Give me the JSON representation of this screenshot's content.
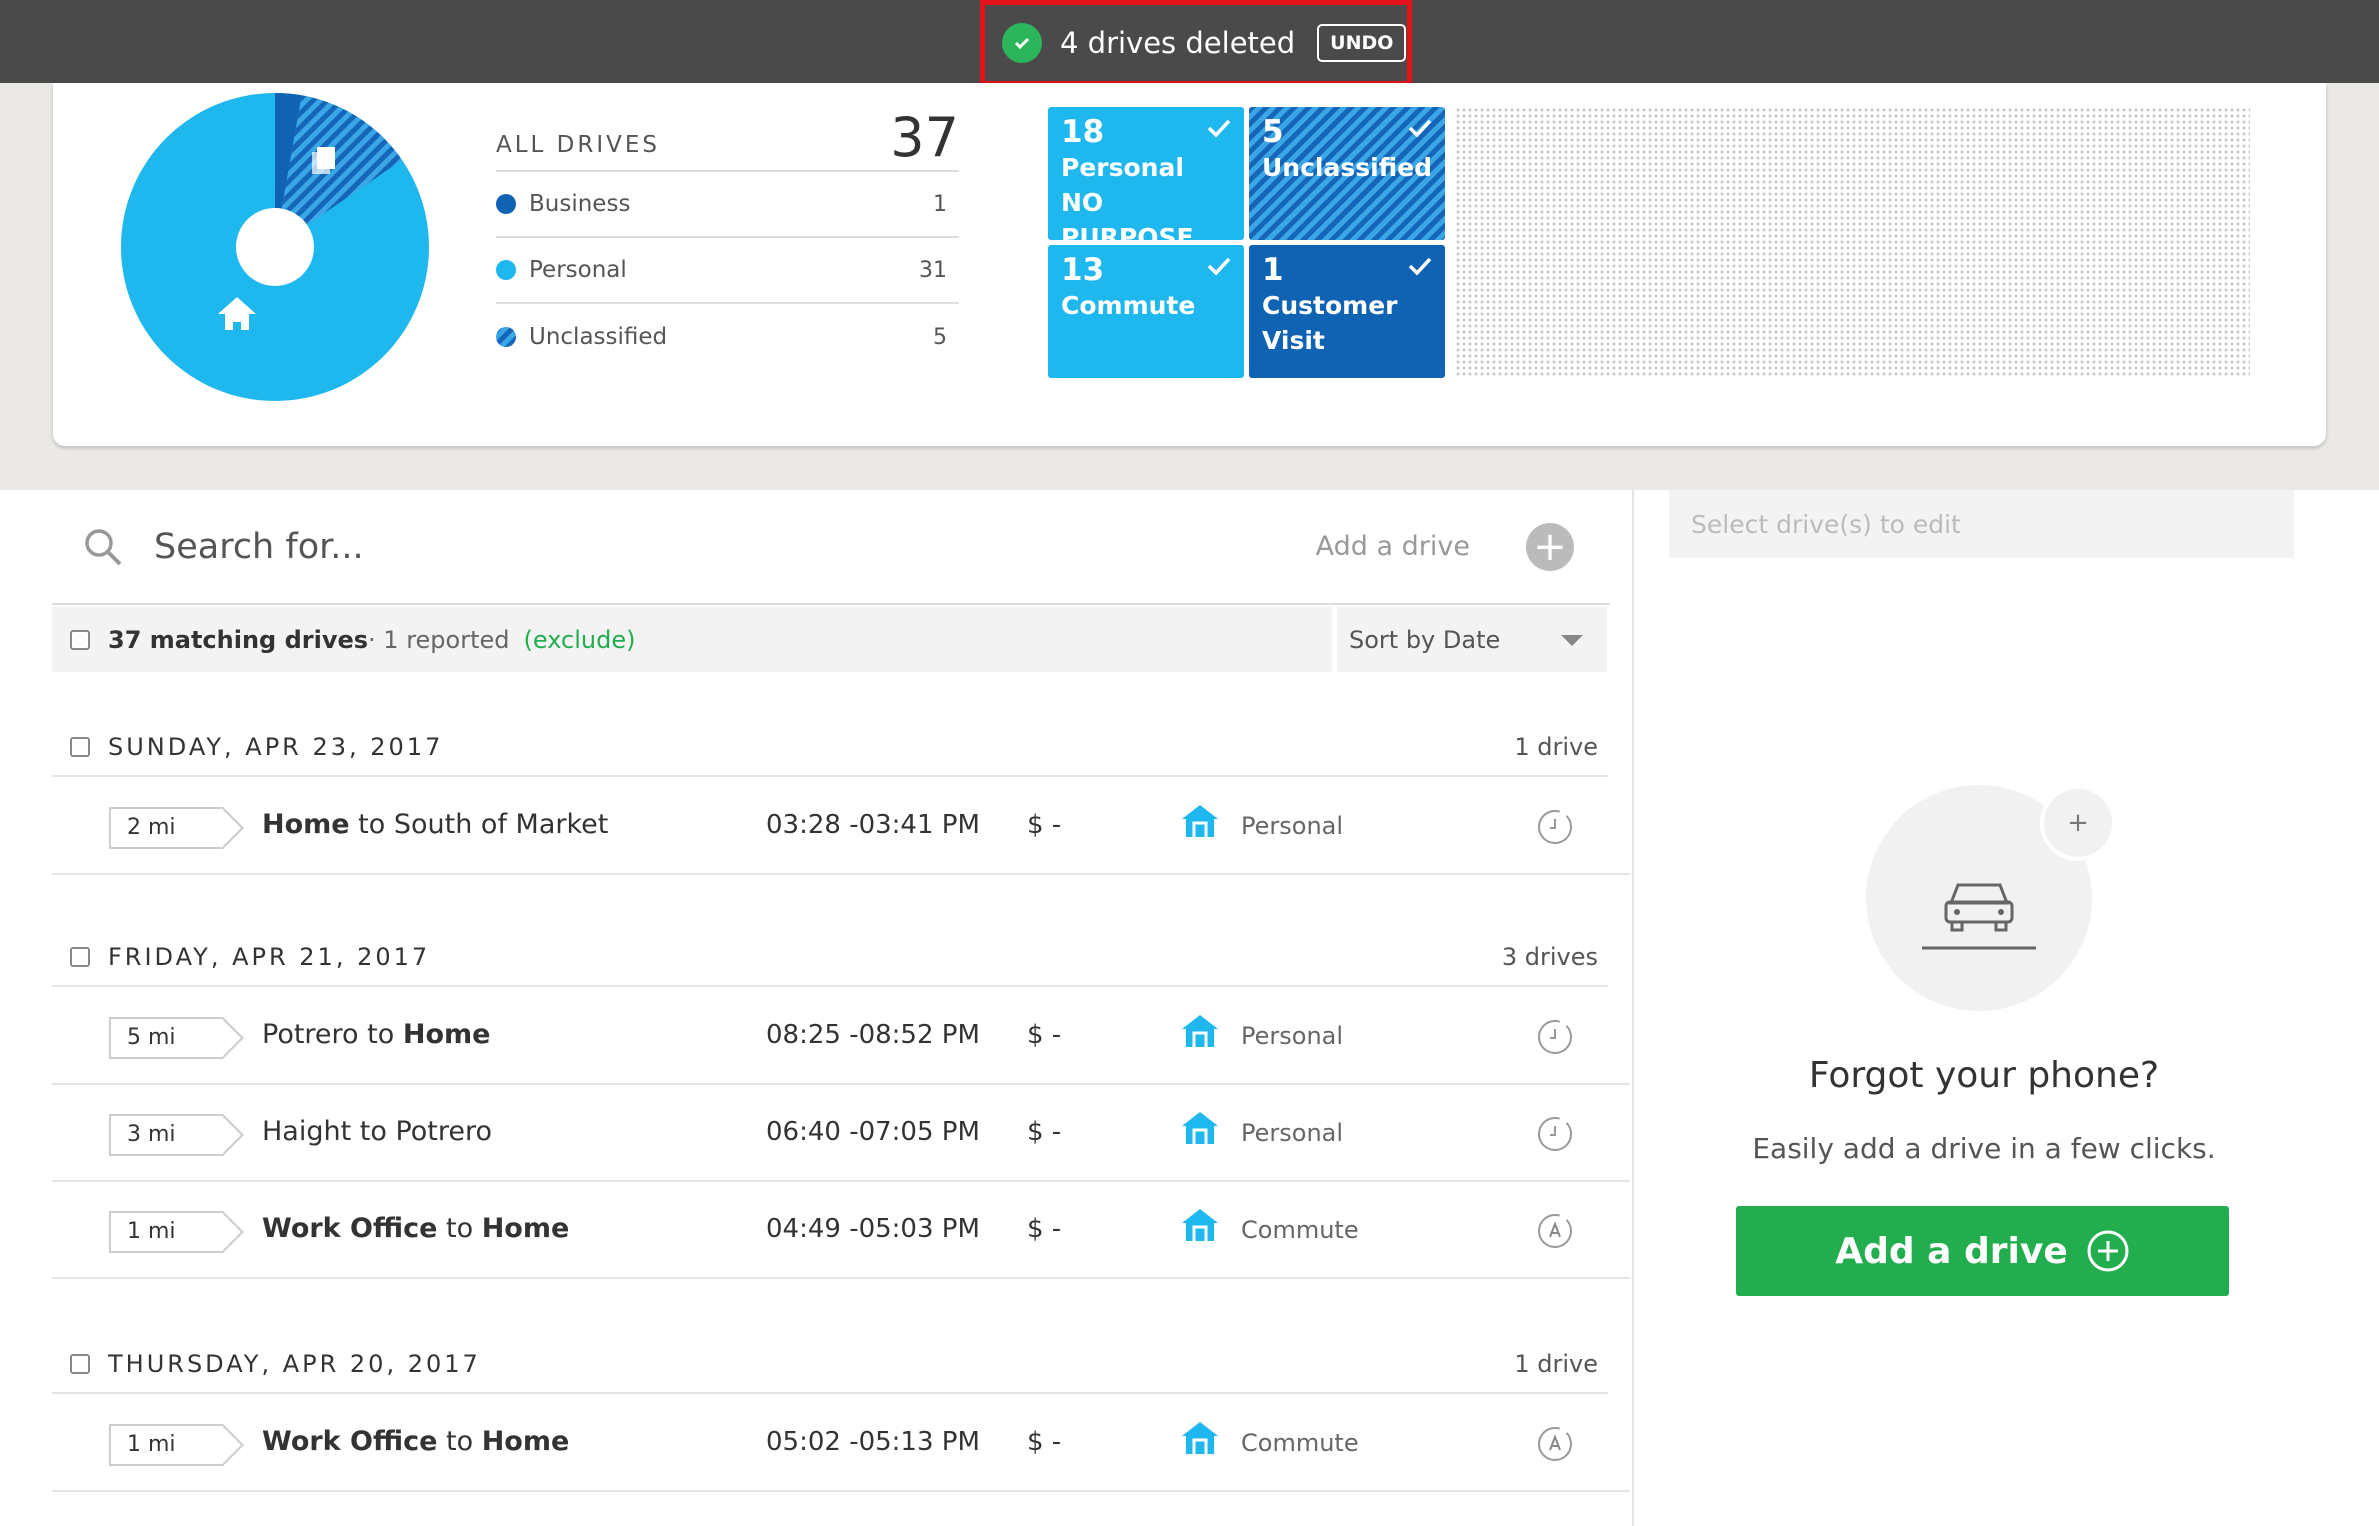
{
  "toast": {
    "message": "4 drives deleted",
    "undo_label": "UNDO"
  },
  "summary": {
    "title": "ALL DRIVES",
    "total": "37",
    "legend": [
      {
        "label": "Business",
        "count": "1",
        "color": "#1063b3"
      },
      {
        "label": "Personal",
        "count": "31",
        "color": "#1fb8ee"
      },
      {
        "label": "Unclassified",
        "count": "5",
        "color": "#1567b8"
      }
    ],
    "tiles": [
      {
        "count": "18",
        "line1": "Personal",
        "line2": "NO PURPOSE",
        "color": "#1fb8ee"
      },
      {
        "count": "5",
        "line1": "Unclassified",
        "line2": "",
        "color": "#1567b8"
      },
      {
        "count": "13",
        "line1": "Commute",
        "line2": "",
        "color": "#1fb8ee"
      },
      {
        "count": "1",
        "line1": "Customer",
        "line2": "Visit",
        "color": "#1063b3"
      }
    ]
  },
  "search": {
    "placeholder": "Search for...",
    "add_drive_label": "Add a drive"
  },
  "filter": {
    "matching": "37 matching drives",
    "reported": " · 1 reported",
    "exclude": "(exclude)",
    "sort_label": "Sort by Date"
  },
  "days": [
    {
      "title": "SUNDAY, APR 23, 2017",
      "count": "1 drive"
    },
    {
      "title": "FRIDAY, APR 21, 2017",
      "count": "3 drives"
    },
    {
      "title": "THURSDAY, APR 20, 2017",
      "count": "1 drive"
    }
  ],
  "drives": [
    {
      "miles": "2 mi",
      "from": "Home",
      "to_word": " to ",
      "dest": "South of Market",
      "time": "03:28 -03:41 PM",
      "money": "$ -",
      "category": "Personal",
      "status": "clock"
    },
    {
      "miles": "5 mi",
      "from": "Potrero",
      "to_word": " to ",
      "dest": "Home",
      "time": "08:25 -08:52 PM",
      "money": "$ -",
      "category": "Personal",
      "status": "clock"
    },
    {
      "miles": "3 mi",
      "from": "Haight",
      "to_word": " to ",
      "dest": "Potrero",
      "time": "06:40 -07:05 PM",
      "money": "$ -",
      "category": "Personal",
      "status": "clock"
    },
    {
      "miles": "1 mi",
      "from": "Work Office",
      "to_word": " to ",
      "dest": "Home",
      "time": "04:49 -05:03 PM",
      "money": "$ -",
      "category": "Commute",
      "status": "auto"
    },
    {
      "miles": "1 mi",
      "from": "Work Office",
      "to_word": " to ",
      "dest": "Home",
      "time": "05:02 -05:13 PM",
      "money": "$ -",
      "category": "Commute",
      "status": "auto"
    }
  ],
  "right_panel": {
    "edit_placeholder": "Select drive(s) to edit",
    "forgot_title": "Forgot your phone?",
    "forgot_sub": "Easily add a drive in a few clicks.",
    "add_button": "Add a drive",
    "plus": "+"
  },
  "colors": {
    "accent_green": "#22ad4e",
    "personal_blue": "#1fb8ee",
    "business_blue": "#1063b3",
    "toast_bg": "#4a4a4a",
    "highlight_red": "#e3121b"
  }
}
